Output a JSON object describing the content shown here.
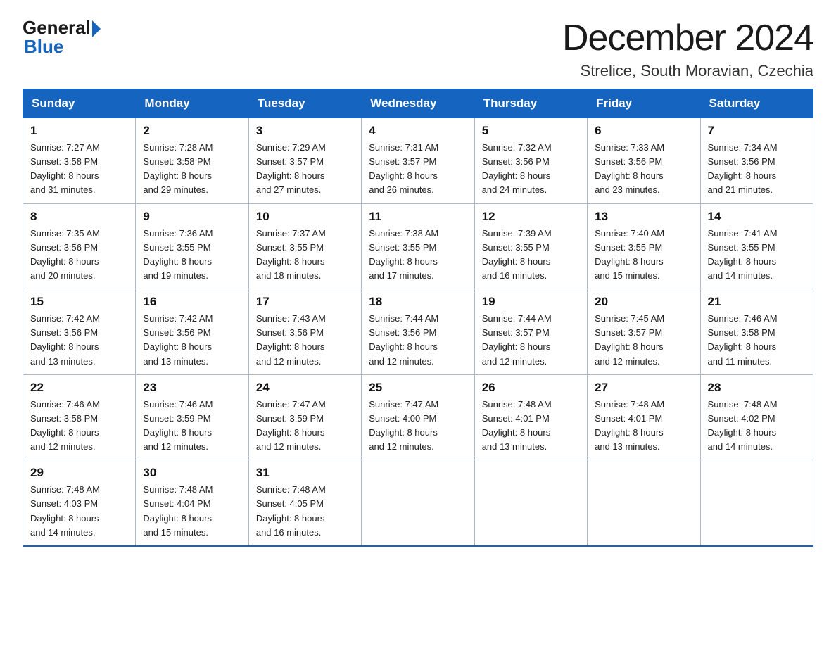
{
  "logo": {
    "general": "General",
    "blue": "Blue"
  },
  "title": "December 2024",
  "subtitle": "Strelice, South Moravian, Czechia",
  "headers": [
    "Sunday",
    "Monday",
    "Tuesday",
    "Wednesday",
    "Thursday",
    "Friday",
    "Saturday"
  ],
  "weeks": [
    [
      {
        "day": "1",
        "info": "Sunrise: 7:27 AM\nSunset: 3:58 PM\nDaylight: 8 hours\nand 31 minutes."
      },
      {
        "day": "2",
        "info": "Sunrise: 7:28 AM\nSunset: 3:58 PM\nDaylight: 8 hours\nand 29 minutes."
      },
      {
        "day": "3",
        "info": "Sunrise: 7:29 AM\nSunset: 3:57 PM\nDaylight: 8 hours\nand 27 minutes."
      },
      {
        "day": "4",
        "info": "Sunrise: 7:31 AM\nSunset: 3:57 PM\nDaylight: 8 hours\nand 26 minutes."
      },
      {
        "day": "5",
        "info": "Sunrise: 7:32 AM\nSunset: 3:56 PM\nDaylight: 8 hours\nand 24 minutes."
      },
      {
        "day": "6",
        "info": "Sunrise: 7:33 AM\nSunset: 3:56 PM\nDaylight: 8 hours\nand 23 minutes."
      },
      {
        "day": "7",
        "info": "Sunrise: 7:34 AM\nSunset: 3:56 PM\nDaylight: 8 hours\nand 21 minutes."
      }
    ],
    [
      {
        "day": "8",
        "info": "Sunrise: 7:35 AM\nSunset: 3:56 PM\nDaylight: 8 hours\nand 20 minutes."
      },
      {
        "day": "9",
        "info": "Sunrise: 7:36 AM\nSunset: 3:55 PM\nDaylight: 8 hours\nand 19 minutes."
      },
      {
        "day": "10",
        "info": "Sunrise: 7:37 AM\nSunset: 3:55 PM\nDaylight: 8 hours\nand 18 minutes."
      },
      {
        "day": "11",
        "info": "Sunrise: 7:38 AM\nSunset: 3:55 PM\nDaylight: 8 hours\nand 17 minutes."
      },
      {
        "day": "12",
        "info": "Sunrise: 7:39 AM\nSunset: 3:55 PM\nDaylight: 8 hours\nand 16 minutes."
      },
      {
        "day": "13",
        "info": "Sunrise: 7:40 AM\nSunset: 3:55 PM\nDaylight: 8 hours\nand 15 minutes."
      },
      {
        "day": "14",
        "info": "Sunrise: 7:41 AM\nSunset: 3:55 PM\nDaylight: 8 hours\nand 14 minutes."
      }
    ],
    [
      {
        "day": "15",
        "info": "Sunrise: 7:42 AM\nSunset: 3:56 PM\nDaylight: 8 hours\nand 13 minutes."
      },
      {
        "day": "16",
        "info": "Sunrise: 7:42 AM\nSunset: 3:56 PM\nDaylight: 8 hours\nand 13 minutes."
      },
      {
        "day": "17",
        "info": "Sunrise: 7:43 AM\nSunset: 3:56 PM\nDaylight: 8 hours\nand 12 minutes."
      },
      {
        "day": "18",
        "info": "Sunrise: 7:44 AM\nSunset: 3:56 PM\nDaylight: 8 hours\nand 12 minutes."
      },
      {
        "day": "19",
        "info": "Sunrise: 7:44 AM\nSunset: 3:57 PM\nDaylight: 8 hours\nand 12 minutes."
      },
      {
        "day": "20",
        "info": "Sunrise: 7:45 AM\nSunset: 3:57 PM\nDaylight: 8 hours\nand 12 minutes."
      },
      {
        "day": "21",
        "info": "Sunrise: 7:46 AM\nSunset: 3:58 PM\nDaylight: 8 hours\nand 11 minutes."
      }
    ],
    [
      {
        "day": "22",
        "info": "Sunrise: 7:46 AM\nSunset: 3:58 PM\nDaylight: 8 hours\nand 12 minutes."
      },
      {
        "day": "23",
        "info": "Sunrise: 7:46 AM\nSunset: 3:59 PM\nDaylight: 8 hours\nand 12 minutes."
      },
      {
        "day": "24",
        "info": "Sunrise: 7:47 AM\nSunset: 3:59 PM\nDaylight: 8 hours\nand 12 minutes."
      },
      {
        "day": "25",
        "info": "Sunrise: 7:47 AM\nSunset: 4:00 PM\nDaylight: 8 hours\nand 12 minutes."
      },
      {
        "day": "26",
        "info": "Sunrise: 7:48 AM\nSunset: 4:01 PM\nDaylight: 8 hours\nand 13 minutes."
      },
      {
        "day": "27",
        "info": "Sunrise: 7:48 AM\nSunset: 4:01 PM\nDaylight: 8 hours\nand 13 minutes."
      },
      {
        "day": "28",
        "info": "Sunrise: 7:48 AM\nSunset: 4:02 PM\nDaylight: 8 hours\nand 14 minutes."
      }
    ],
    [
      {
        "day": "29",
        "info": "Sunrise: 7:48 AM\nSunset: 4:03 PM\nDaylight: 8 hours\nand 14 minutes."
      },
      {
        "day": "30",
        "info": "Sunrise: 7:48 AM\nSunset: 4:04 PM\nDaylight: 8 hours\nand 15 minutes."
      },
      {
        "day": "31",
        "info": "Sunrise: 7:48 AM\nSunset: 4:05 PM\nDaylight: 8 hours\nand 16 minutes."
      },
      null,
      null,
      null,
      null
    ]
  ]
}
